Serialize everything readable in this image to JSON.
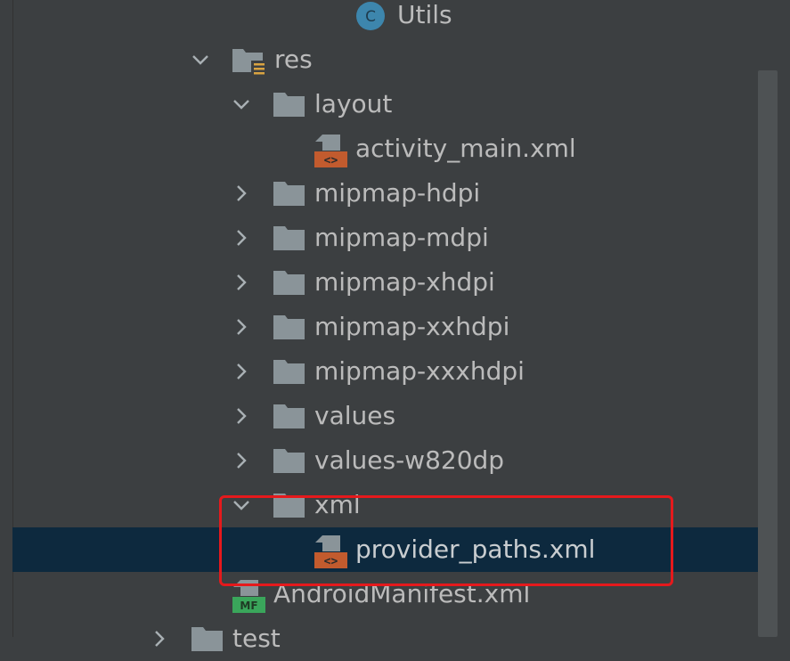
{
  "tree": {
    "items": [
      {
        "label": "Utils",
        "icon": "class-c-icon",
        "state": "leaf"
      },
      {
        "label": "res",
        "icon": "resource-folder-icon",
        "state": "expanded"
      },
      {
        "label": "layout",
        "icon": "folder-icon",
        "state": "expanded"
      },
      {
        "label": "activity_main.xml",
        "icon": "layout-xml-icon",
        "state": "leaf"
      },
      {
        "label": "mipmap-hdpi",
        "icon": "folder-icon",
        "state": "collapsed"
      },
      {
        "label": "mipmap-mdpi",
        "icon": "folder-icon",
        "state": "collapsed"
      },
      {
        "label": "mipmap-xhdpi",
        "icon": "folder-icon",
        "state": "collapsed"
      },
      {
        "label": "mipmap-xxhdpi",
        "icon": "folder-icon",
        "state": "collapsed"
      },
      {
        "label": "mipmap-xxxhdpi",
        "icon": "folder-icon",
        "state": "collapsed"
      },
      {
        "label": "values",
        "icon": "folder-icon",
        "state": "collapsed"
      },
      {
        "label": "values-w820dp",
        "icon": "folder-icon",
        "state": "collapsed"
      },
      {
        "label": "xml",
        "icon": "folder-icon",
        "state": "expanded"
      },
      {
        "label": "provider_paths.xml",
        "icon": "layout-xml-icon",
        "state": "leaf",
        "selected": true
      },
      {
        "label": "AndroidManifest.xml",
        "icon": "manifest-icon",
        "state": "leaf"
      },
      {
        "label": "test",
        "icon": "folder-icon",
        "state": "collapsed"
      }
    ]
  },
  "icons": {
    "class_letter": "C",
    "xml_glyph": "<>",
    "manifest_glyph": "MF"
  },
  "colors": {
    "background": "#3c3f41",
    "selection": "#0d293e",
    "highlight_box": "#e5191c",
    "folder": "#8a9499",
    "class_icon": "#3d86ad",
    "xml_icon": "#c25b2e",
    "manifest_icon": "#3aa65b"
  }
}
